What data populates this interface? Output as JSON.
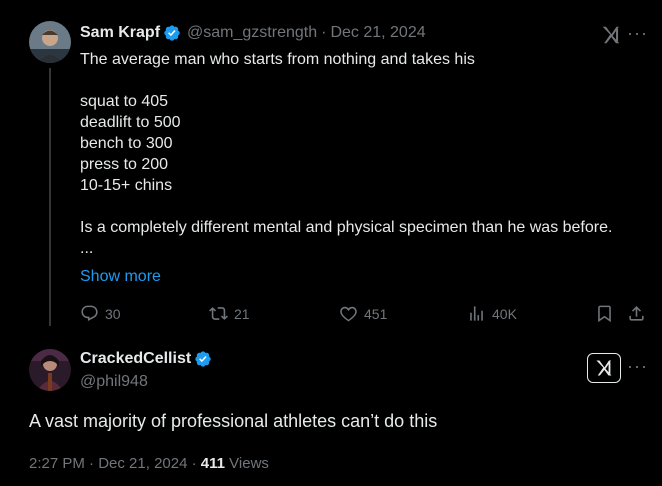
{
  "original_tweet": {
    "author_name": "Sam Krapf",
    "handle": "@sam_gzstrength",
    "separator": "·",
    "date": "Dec 21, 2024",
    "text": "The average man who starts from nothing and takes his\n\nsquat to 405\ndeadlift to 500\nbench to 300\npress to 200\n10-15+ chins\n\nIs a completely different mental and physical specimen than he was before.\n...",
    "show_more": "Show more",
    "replies": "30",
    "retweets": "21",
    "likes": "451",
    "views": "40K"
  },
  "reply_tweet": {
    "author_name": "CrackedCellist",
    "handle": "@phil948",
    "text": "A vast majority of professional athletes can’t do this",
    "time": "2:27 PM",
    "sep1": "·",
    "date": "Dec 21, 2024",
    "sep2": "·",
    "views_count": "411",
    "views_label": "Views"
  },
  "colors": {
    "background": "#000000",
    "text": "#e7e9ea",
    "secondary": "#71767b",
    "link": "#1d9bf0",
    "verified": "#1d9bf0"
  },
  "icons": [
    "verified-badge-icon",
    "grok-icon",
    "more-icon",
    "reply-icon",
    "retweet-icon",
    "like-icon",
    "views-icon",
    "bookmark-icon",
    "share-icon"
  ]
}
